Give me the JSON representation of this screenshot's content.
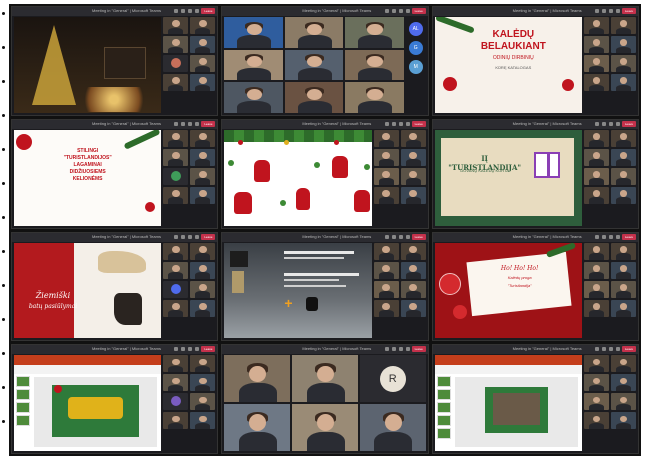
{
  "meeting": {
    "window_title": "Meeting in \"General\" | Microsoft Teams",
    "leave_label": "Leave",
    "colors": {
      "leave": "#c4314b",
      "christmas_red": "#c0141e",
      "green": "#2d6b2a"
    }
  },
  "panels": {
    "p2": {
      "avatars": [
        "AL",
        "G",
        "M"
      ]
    },
    "p3": {
      "line1": "KALĖDŲ",
      "line2": "BELAUKIANT",
      "line3": "ODINIŲ DIRBINIŲ",
      "line4": "KŪRĘ KATALOGAS"
    },
    "p4": {
      "line1": "STILINGI",
      "line2": "\"TURISTLANDIJOS\"",
      "line3": "LAGAMINAI",
      "line4": "DIDŽIUOSIEMS",
      "line5": "KELIONĖMS"
    },
    "p6": {
      "line1": "IĮ \"TURISTLANDIJA\"",
      "line2": "DOVANŲ KALĖDŲ KORTA"
    },
    "p7": {
      "line1": "Žiemiški",
      "line2": "batų pasiūlymai"
    },
    "p9": {
      "line1": "Ho! Ho! Ho!",
      "line2": "Kalėdų proga",
      "line3": "\"Turistlandija\""
    },
    "p11": {
      "avatar": "R"
    }
  }
}
